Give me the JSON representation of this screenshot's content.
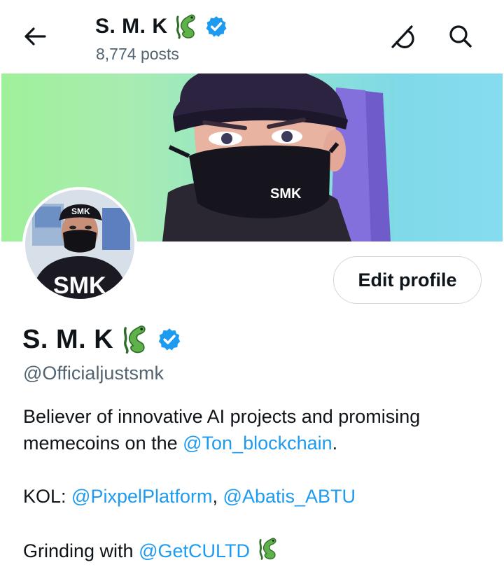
{
  "header": {
    "name": "S. M. K",
    "posts_count": "8,774 posts"
  },
  "profile": {
    "name": "S. M. K",
    "handle": "@Officialjustsmk",
    "banner_mask_text": "SMK",
    "avatar_hood_text": "SMK",
    "avatar_cap_text": "SMK",
    "edit_button_label": "Edit profile"
  },
  "bio": {
    "line1_text": "Believer of innovative AI projects and promising memecoins on the ",
    "line1_mention": "@Ton_blockchain",
    "line1_end": ".",
    "kol_prefix": "KOL: ",
    "kol_mention_1": "@PixpelPlatform",
    "kol_sep": ", ",
    "kol_mention_2": "@Abatis_ABTU",
    "grinding_prefix": "Grinding with ",
    "grinding_mention": "@GetCULTD"
  },
  "icons": {
    "back": "arrow-left-icon",
    "grok": "grok-icon",
    "search": "search-icon",
    "verified": "verified-badge-icon",
    "dragon": "dragon-emoji-icon"
  },
  "colors": {
    "accent": "#1d9bf0",
    "secondary_text": "#536471",
    "primary_text": "#0f1419",
    "dragon_green": "#5fb14a"
  }
}
